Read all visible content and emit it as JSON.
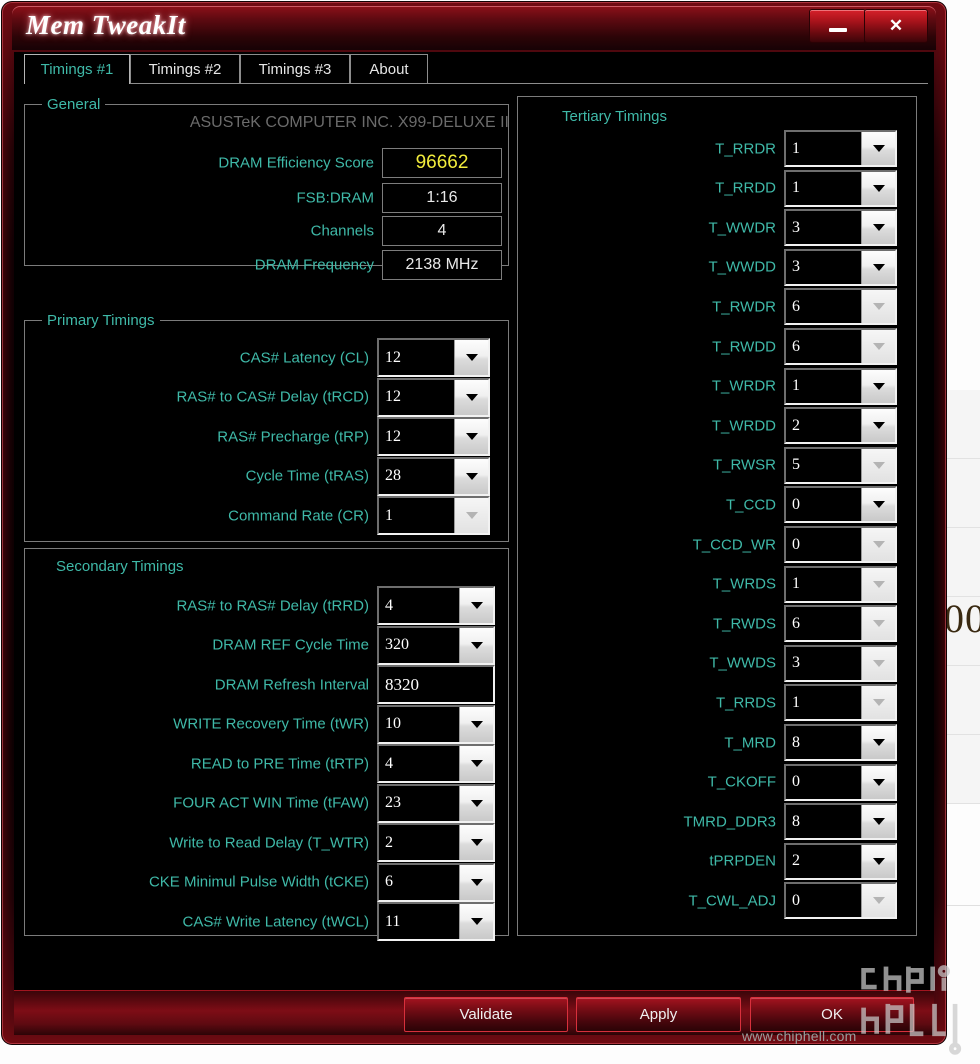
{
  "window": {
    "title": "Mem TweakIt",
    "minimize_label": "minimize",
    "close_label": "✕"
  },
  "tabs": [
    {
      "label": "Timings #1",
      "active": true
    },
    {
      "label": "Timings #2",
      "active": false
    },
    {
      "label": "Timings #3",
      "active": false
    },
    {
      "label": "About",
      "active": false
    }
  ],
  "general": {
    "legend": "General",
    "motherboard": "ASUSTeK COMPUTER INC. X99-DELUXE II",
    "rows": [
      {
        "label": "DRAM Efficiency Score",
        "value": "96662",
        "accent": true
      },
      {
        "label": "FSB:DRAM",
        "value": "1:16",
        "accent": false
      },
      {
        "label": "Channels",
        "value": "4",
        "accent": false
      },
      {
        "label": "DRAM Frequency",
        "value": "2138 MHz",
        "accent": false
      }
    ]
  },
  "primary": {
    "legend": "Primary Timings",
    "rows": [
      {
        "label": "CAS# Latency (CL)",
        "value": "12",
        "disabled": false
      },
      {
        "label": "RAS# to CAS# Delay (tRCD)",
        "value": "12",
        "disabled": false
      },
      {
        "label": "RAS# Precharge (tRP)",
        "value": "12",
        "disabled": false
      },
      {
        "label": "Cycle Time (tRAS)",
        "value": "28",
        "disabled": false
      },
      {
        "label": "Command Rate (CR)",
        "value": "1",
        "disabled": true
      }
    ]
  },
  "secondary": {
    "legend": "Secondary Timings",
    "rows": [
      {
        "label": "RAS# to RAS# Delay (tRRD)",
        "value": "4",
        "type": "combo",
        "disabled": false
      },
      {
        "label": "DRAM REF Cycle Time",
        "value": "320",
        "type": "combo",
        "disabled": false
      },
      {
        "label": "DRAM Refresh Interval",
        "value": "8320",
        "type": "text",
        "disabled": false
      },
      {
        "label": "WRITE Recovery Time (tWR)",
        "value": "10",
        "type": "combo",
        "disabled": false
      },
      {
        "label": "READ to PRE Time (tRTP)",
        "value": "4",
        "type": "combo",
        "disabled": false
      },
      {
        "label": "FOUR ACT WIN Time (tFAW)",
        "value": "23",
        "type": "combo",
        "disabled": false
      },
      {
        "label": "Write to Read Delay (T_WTR)",
        "value": "2",
        "type": "combo",
        "disabled": false
      },
      {
        "label": "CKE Minimul Pulse Width (tCKE)",
        "value": "6",
        "type": "combo",
        "disabled": false
      },
      {
        "label": "CAS# Write Latency (tWCL)",
        "value": "11",
        "type": "combo",
        "disabled": false
      }
    ]
  },
  "tertiary": {
    "legend": "Tertiary Timings",
    "rows": [
      {
        "label": "T_RRDR",
        "value": "1",
        "disabled": false
      },
      {
        "label": "T_RRDD",
        "value": "1",
        "disabled": false
      },
      {
        "label": "T_WWDR",
        "value": "3",
        "disabled": false
      },
      {
        "label": "T_WWDD",
        "value": "3",
        "disabled": false
      },
      {
        "label": "T_RWDR",
        "value": "6",
        "disabled": true
      },
      {
        "label": "T_RWDD",
        "value": "6",
        "disabled": true
      },
      {
        "label": "T_WRDR",
        "value": "1",
        "disabled": false
      },
      {
        "label": "T_WRDD",
        "value": "2",
        "disabled": false
      },
      {
        "label": "T_RWSR",
        "value": "5",
        "disabled": true
      },
      {
        "label": "T_CCD",
        "value": "0",
        "disabled": false
      },
      {
        "label": "T_CCD_WR",
        "value": "0",
        "disabled": true
      },
      {
        "label": "T_WRDS",
        "value": "1",
        "disabled": true
      },
      {
        "label": "T_RWDS",
        "value": "6",
        "disabled": true
      },
      {
        "label": "T_WWDS",
        "value": "3",
        "disabled": true
      },
      {
        "label": "T_RRDS",
        "value": "1",
        "disabled": true
      },
      {
        "label": "T_MRD",
        "value": "8",
        "disabled": false
      },
      {
        "label": "T_CKOFF",
        "value": "0",
        "disabled": false
      },
      {
        "label": "TMRD_DDR3",
        "value": "8",
        "disabled": false
      },
      {
        "label": "tPRPDEN",
        "value": "2",
        "disabled": false
      },
      {
        "label": "T_CWL_ADJ",
        "value": "0",
        "disabled": true
      }
    ]
  },
  "footer": {
    "validate_label": "Validate",
    "apply_label": "Apply",
    "ok_label": "OK",
    "site_url": "www.chiphell.com",
    "watermark": "chiphell"
  },
  "background": {
    "partial_number": "00"
  },
  "colors": {
    "accent_teal": "#3fb9a8",
    "score_yellow": "#f2ed3c",
    "brand_red": "#a51320"
  }
}
